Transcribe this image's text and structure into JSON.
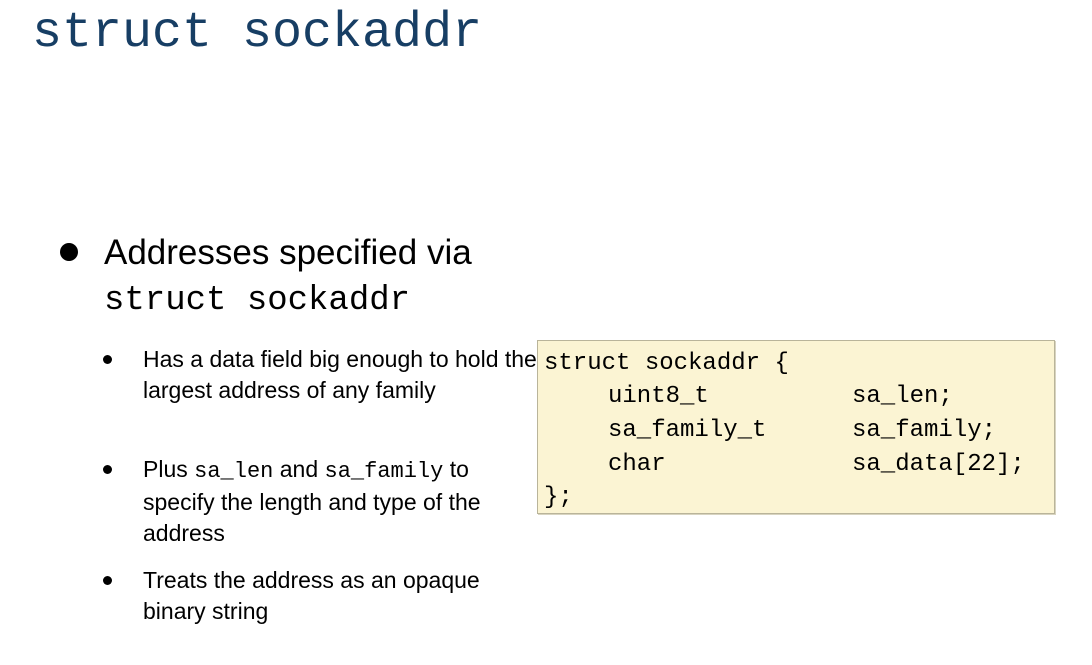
{
  "slide": {
    "title": "struct sockaddr"
  },
  "main_bullet": {
    "text": "Addresses specified via",
    "code": "struct sockaddr"
  },
  "sub_bullets": [
    {
      "text": "Has a data field big enough to hold the largest address of any family"
    },
    {
      "prefix": "Plus ",
      "code1": "sa_len",
      "middle": " and ",
      "code2": "sa_family",
      "suffix": " to specify the length and type of the address"
    },
    {
      "text": "Treats the address as an opaque binary string"
    }
  ],
  "code_block": {
    "open": "struct sockaddr {",
    "fields": [
      {
        "type": "uint8_t",
        "name": "sa_len;"
      },
      {
        "type": "sa_family_t",
        "name": "sa_family;"
      },
      {
        "type": "char",
        "name": "sa_data[22];"
      }
    ],
    "close": "};"
  },
  "colors": {
    "title": "#173e64",
    "code_background": "#fbf4d3",
    "code_border": "#b9b49a"
  }
}
